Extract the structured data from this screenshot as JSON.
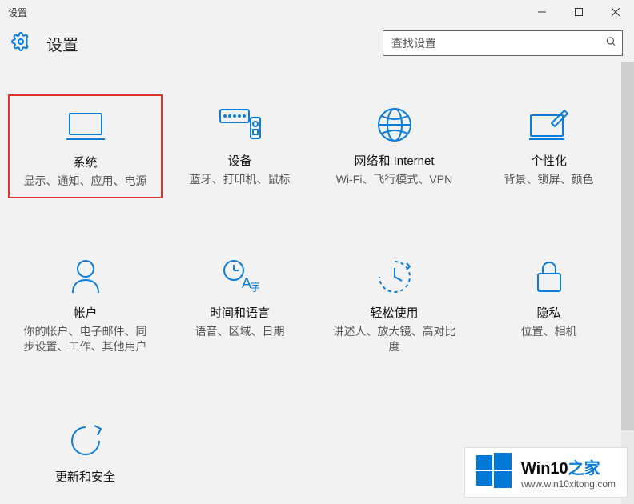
{
  "window": {
    "title": "设置",
    "minimize_label": "minimize",
    "maximize_label": "maximize",
    "close_label": "close"
  },
  "header": {
    "title": "设置"
  },
  "search": {
    "placeholder": "查找设置",
    "value": ""
  },
  "tiles": [
    {
      "id": "system",
      "title": "系统",
      "desc": "显示、通知、应用、电源",
      "highlight": true
    },
    {
      "id": "devices",
      "title": "设备",
      "desc": "蓝牙、打印机、鼠标",
      "highlight": false
    },
    {
      "id": "network",
      "title": "网络和 Internet",
      "desc": "Wi-Fi、飞行模式、VPN",
      "highlight": false
    },
    {
      "id": "personalization",
      "title": "个性化",
      "desc": "背景、锁屏、颜色",
      "highlight": false
    },
    {
      "id": "accounts",
      "title": "帐户",
      "desc": "你的帐户、电子邮件、同步设置、工作、其他用户",
      "highlight": false
    },
    {
      "id": "time_language",
      "title": "时间和语言",
      "desc": "语音、区域、日期",
      "highlight": false
    },
    {
      "id": "ease_of_access",
      "title": "轻松使用",
      "desc": "讲述人、放大镜、高对比度",
      "highlight": false
    },
    {
      "id": "privacy",
      "title": "隐私",
      "desc": "位置、相机",
      "highlight": false
    },
    {
      "id": "update_security",
      "title": "更新和安全",
      "desc": "",
      "highlight": false
    }
  ],
  "watermark": {
    "brand_part1": "Win10",
    "brand_part2": "之家",
    "url": "www.win10xitong.com"
  }
}
